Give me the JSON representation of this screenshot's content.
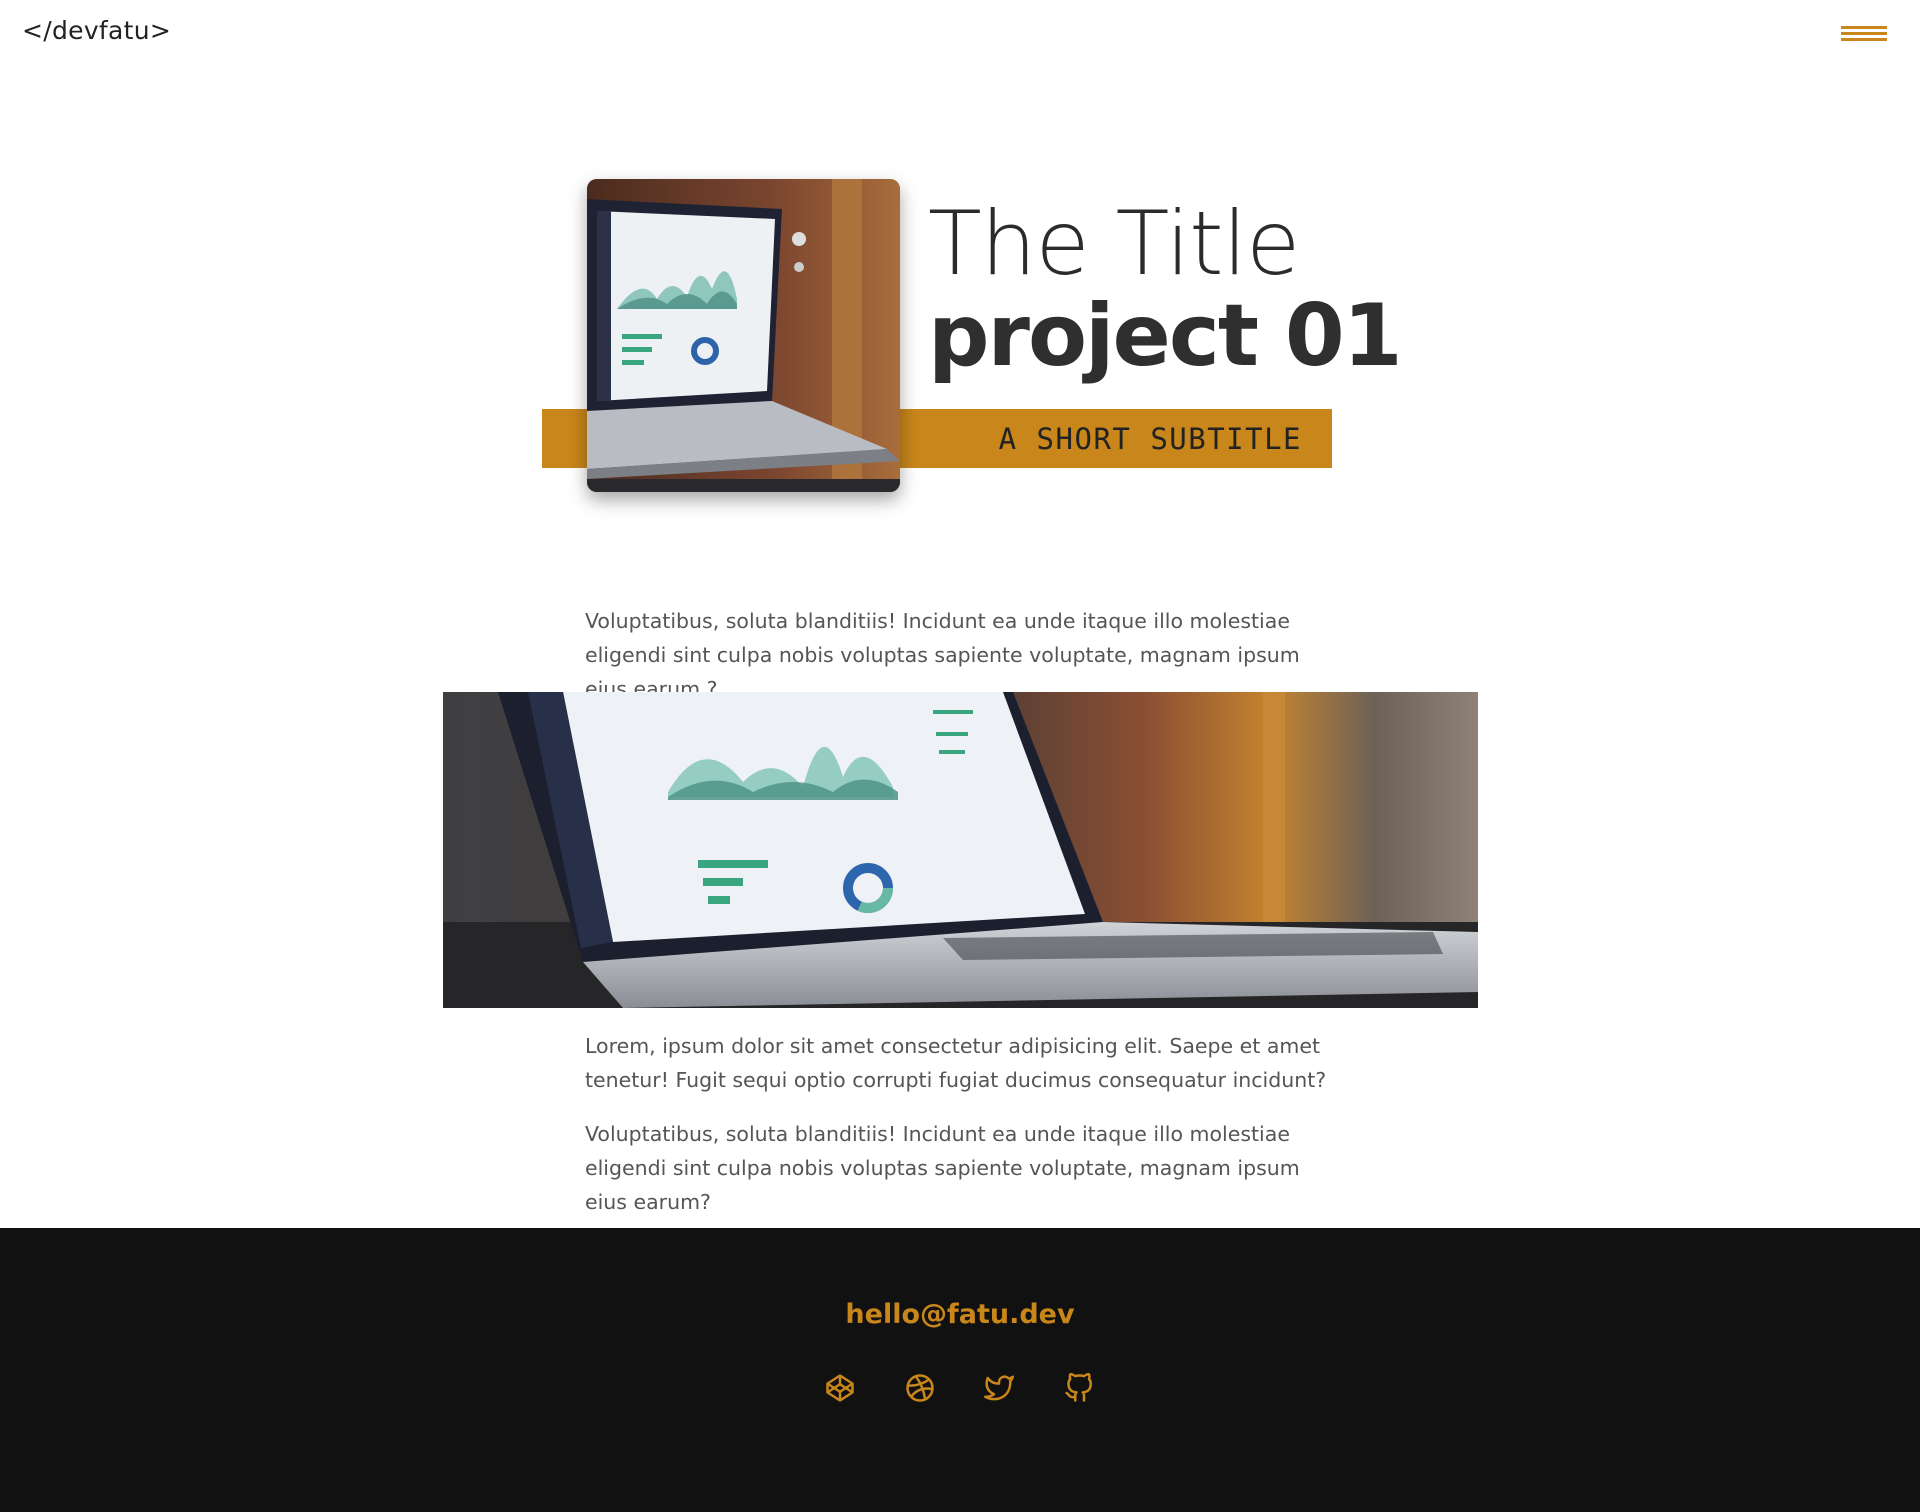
{
  "header": {
    "logo": "</devfatu>",
    "menu_icon": "hamburger-menu-icon",
    "accent_color": "#c8861b"
  },
  "hero": {
    "title_line1": "The Title",
    "title_line2": "project 01",
    "subtitle": "A SHORT SUBTITLE",
    "thumbnail": "laptop-dashboard-photo"
  },
  "content": {
    "paragraph1": "Voluptatibus, soluta blanditiis! Incidunt ea unde itaque illo molestiae eligendi sint culpa nobis voluptas sapiente voluptate, magnam ipsum eius earum ?",
    "image": "laptop-dashboard-wide-photo",
    "paragraph2": "Lorem, ipsum dolor sit amet consectetur adipisicing elit. Saepe et amet tenetur! Fugit sequi optio corrupti fugiat ducimus consequatur incidunt?",
    "paragraph3": "Voluptatibus, soluta blanditiis! Incidunt ea unde itaque illo molestiae eligendi sint culpa nobis voluptas sapiente voluptate, magnam ipsum eius earum?"
  },
  "footer": {
    "email": "hello@fatu.dev",
    "background_color": "#111111",
    "social_icons": [
      "codepen-icon",
      "dribbble-icon",
      "twitter-icon",
      "github-icon"
    ]
  }
}
